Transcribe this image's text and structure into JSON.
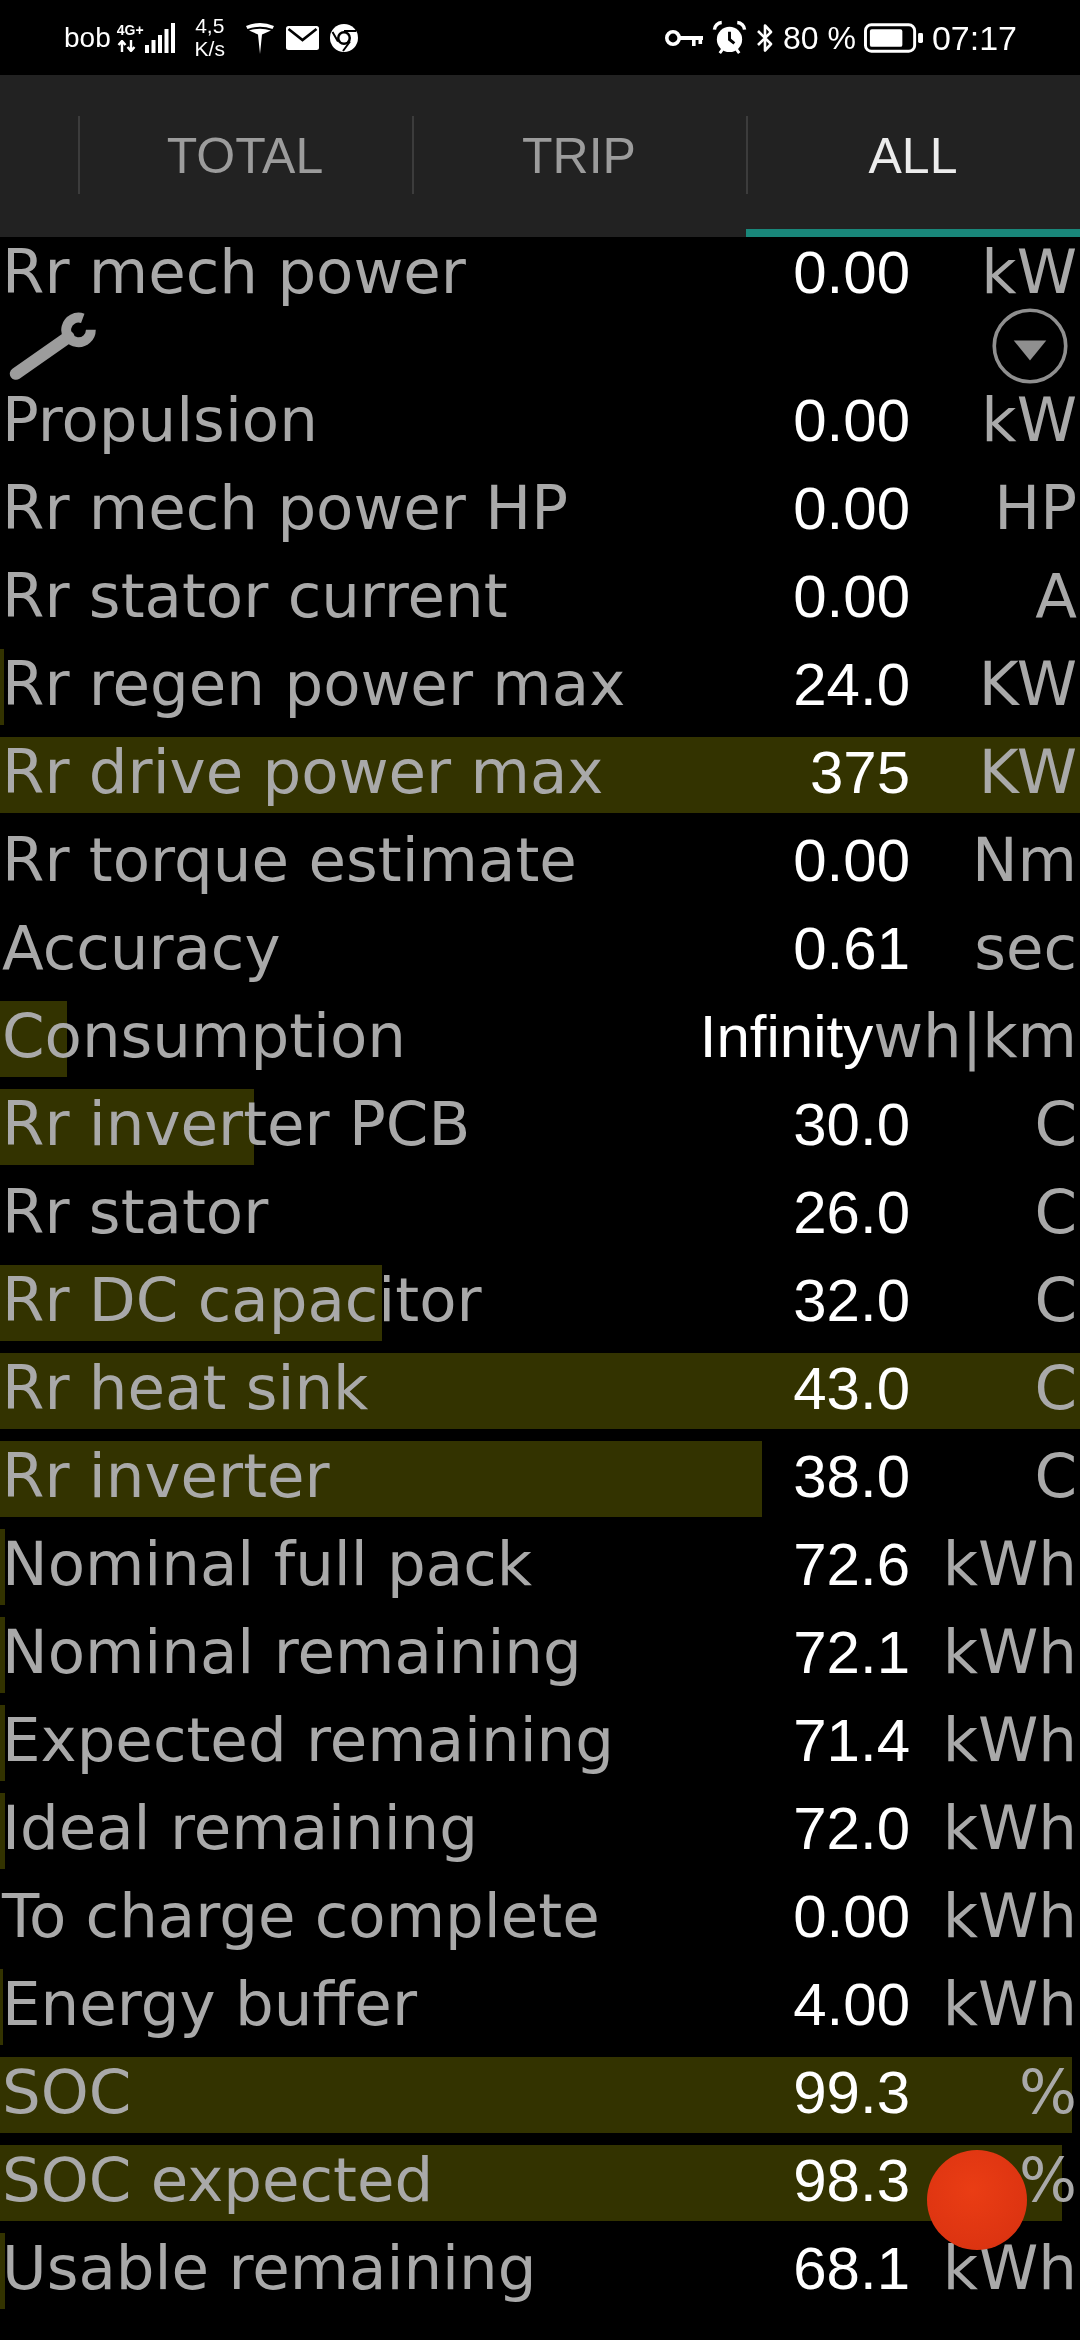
{
  "status_bar": {
    "carrier": "bob",
    "network_type": "4G+",
    "speed": "4,5",
    "speed_unit": "K/s",
    "battery": "80 %",
    "time": "07:17"
  },
  "tabs": [
    {
      "label": "TOTAL",
      "selected": false
    },
    {
      "label": "TRIP",
      "selected": false
    },
    {
      "label": "ALL",
      "selected": true
    }
  ],
  "rows": [
    {
      "label": "Rr mech power",
      "value": "0.00",
      "unit": "kW"
    },
    {
      "label": "Propulsion",
      "value": "0.00",
      "unit": "kW"
    },
    {
      "label": "Rr mech power HP",
      "value": "0.00",
      "unit": "HP"
    },
    {
      "label": "Rr stator current",
      "value": "0.00",
      "unit": "A"
    },
    {
      "label": "Rr regen power max",
      "value": "24.0",
      "unit": "KW",
      "level": 0.004
    },
    {
      "label": "Rr drive power max",
      "value": "375",
      "unit": "KW",
      "level": 1
    },
    {
      "label": "Rr torque estimate",
      "value": "0.00",
      "unit": "Nm"
    },
    {
      "label": "Accuracy",
      "value": "0.61",
      "unit": "sec"
    },
    {
      "label": "Consumption",
      "value": "Infinity",
      "unit": "wh|km",
      "level": 0.062
    },
    {
      "label": "Rr inverter PCB",
      "value": "30.0",
      "unit": "C",
      "level": 0.235
    },
    {
      "label": "Rr stator",
      "value": "26.0",
      "unit": "C"
    },
    {
      "label": "Rr DC capacitor",
      "value": "32.0",
      "unit": "C",
      "level": 0.354
    },
    {
      "label": "Rr heat sink",
      "value": "43.0",
      "unit": "C",
      "level": 1
    },
    {
      "label": "Rr inverter",
      "value": "38.0",
      "unit": "C",
      "level": 0.706
    },
    {
      "label": "Nominal full pack",
      "value": "72.6",
      "unit": "kWh",
      "level": 0.005
    },
    {
      "label": "Nominal remaining",
      "value": "72.1",
      "unit": "kWh",
      "level": 0.005
    },
    {
      "label": "Expected remaining",
      "value": "71.4",
      "unit": "kWh",
      "level": 0.005
    },
    {
      "label": "Ideal remaining",
      "value": "72.0",
      "unit": "kWh",
      "level": 0.005
    },
    {
      "label": "To charge complete",
      "value": "0.00",
      "unit": "kWh"
    },
    {
      "label": "Energy buffer",
      "value": "4.00",
      "unit": "kWh",
      "level": 0.003
    },
    {
      "label": "SOC",
      "value": "99.3",
      "unit": "%",
      "level": 0.993
    },
    {
      "label": "SOC expected",
      "value": "98.3",
      "unit": "%",
      "level": 0.983
    },
    {
      "label": "Usable remaining",
      "value": "68.1",
      "unit": "kWh",
      "level": 0.005
    }
  ]
}
